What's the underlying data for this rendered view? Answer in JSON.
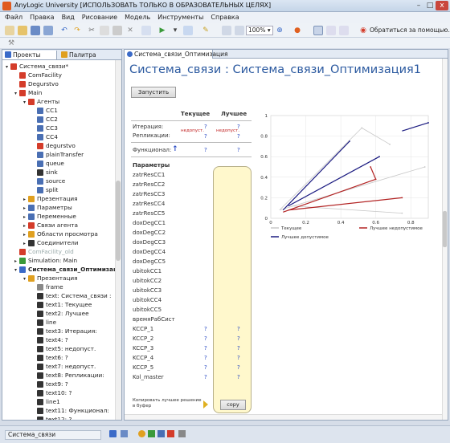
{
  "window": {
    "title": "AnyLogic University [ИСПОЛЬЗОВАТЬ ТОЛЬКО В ОБРАЗОВАТЕЛЬНЫХ ЦЕЛЯХ]",
    "minimize": "–",
    "maximize": "□",
    "close": "x"
  },
  "menu": [
    "Файл",
    "Правка",
    "Вид",
    "Рисование",
    "Модель",
    "Инструменты",
    "Справка"
  ],
  "toolbar": {
    "zoom": "100%",
    "support_label": "Обратиться за помощью..."
  },
  "left_panel": {
    "tabs": [
      "Проекты",
      "Палитра"
    ],
    "tree": [
      {
        "label": "Система_связи*",
        "indent": 0,
        "expander": "▾",
        "icon": "model-icon",
        "color": "#d43c2a"
      },
      {
        "label": "ComFacility",
        "indent": 1,
        "expander": "",
        "icon": "agent-icon",
        "color": "#d43c2a"
      },
      {
        "label": "Degurstvo",
        "indent": 1,
        "expander": "",
        "icon": "agent-icon",
        "color": "#d43c2a"
      },
      {
        "label": "Main",
        "indent": 1,
        "expander": "▾",
        "icon": "agent-icon",
        "color": "#d43c2a"
      },
      {
        "label": "Агенты",
        "indent": 2,
        "expander": "▾",
        "icon": "agents-icon",
        "color": "#d43c2a"
      },
      {
        "label": "CC1",
        "indent": 3,
        "expander": "",
        "icon": "service-icon",
        "color": "#4a6fb3"
      },
      {
        "label": "CC2",
        "indent": 3,
        "expander": "",
        "icon": "service-icon",
        "color": "#4a6fb3"
      },
      {
        "label": "CC3",
        "indent": 3,
        "expander": "",
        "icon": "service-icon",
        "color": "#4a6fb3"
      },
      {
        "label": "CC4",
        "indent": 3,
        "expander": "",
        "icon": "service-icon",
        "color": "#4a6fb3"
      },
      {
        "label": "degurstvo",
        "indent": 3,
        "expander": "",
        "icon": "agent-icon",
        "color": "#d43c2a"
      },
      {
        "label": "plainTransfer",
        "indent": 3,
        "expander": "",
        "icon": "block-icon",
        "color": "#4a6fb3"
      },
      {
        "label": "queue",
        "indent": 3,
        "expander": "",
        "icon": "queue-icon",
        "color": "#4a6fb3"
      },
      {
        "label": "sink",
        "indent": 3,
        "expander": "",
        "icon": "sink-icon",
        "color": "#333333"
      },
      {
        "label": "source",
        "indent": 3,
        "expander": "",
        "icon": "source-icon",
        "color": "#4a6fb3"
      },
      {
        "label": "split",
        "indent": 3,
        "expander": "",
        "icon": "split-icon",
        "color": "#4a6fb3"
      },
      {
        "label": "Презентация",
        "indent": 2,
        "expander": "▸",
        "icon": "presentation-icon",
        "color": "#e0a020"
      },
      {
        "label": "Параметры",
        "indent": 2,
        "expander": "▸",
        "icon": "parameters-icon",
        "color": "#4a6fb3"
      },
      {
        "label": "Переменные",
        "indent": 2,
        "expander": "▸",
        "icon": "variables-icon",
        "color": "#4a6fb3"
      },
      {
        "label": "Связи агента",
        "indent": 2,
        "expander": "▸",
        "icon": "links-icon",
        "color": "#d43c2a"
      },
      {
        "label": "Области просмотра",
        "indent": 2,
        "expander": "▸",
        "icon": "viewarea-icon",
        "color": "#e0a020"
      },
      {
        "label": "Соединители",
        "indent": 2,
        "expander": "▸",
        "icon": "connectors-icon",
        "color": "#333333"
      },
      {
        "label": "ComFacility_old",
        "indent": 1,
        "expander": "",
        "icon": "agent-icon",
        "color": "#d43c2a",
        "dim": true
      },
      {
        "label": "Simulation: Main",
        "indent": 1,
        "expander": "▸",
        "icon": "experiment-icon",
        "color": "#3a9a3a"
      },
      {
        "label": "Система_связи_Оптимизац",
        "indent": 1,
        "expander": "▾",
        "icon": "optimization-icon",
        "color": "#3a6ac8",
        "bold": true
      },
      {
        "label": "Презентация",
        "indent": 2,
        "expander": "▾",
        "icon": "presentation-icon",
        "color": "#e0a020"
      },
      {
        "label": "frame",
        "indent": 3,
        "expander": "",
        "icon": "frame-icon",
        "color": "#888888"
      },
      {
        "label": "text: Система_связи :",
        "indent": 3,
        "expander": "",
        "icon": "text-icon",
        "color": "#333333"
      },
      {
        "label": "text1: Текущее",
        "indent": 3,
        "expander": "",
        "icon": "text-icon",
        "color": "#333333"
      },
      {
        "label": "text2: Лучшее",
        "indent": 3,
        "expander": "",
        "icon": "text-icon",
        "color": "#333333"
      },
      {
        "label": "line",
        "indent": 3,
        "expander": "",
        "icon": "line-icon",
        "color": "#333333"
      },
      {
        "label": "text3: Итерация:",
        "indent": 3,
        "expander": "",
        "icon": "text-icon",
        "color": "#333333"
      },
      {
        "label": "text4: ?",
        "indent": 3,
        "expander": "",
        "icon": "text-icon",
        "color": "#333333"
      },
      {
        "label": "text5: недопуст.",
        "indent": 3,
        "expander": "",
        "icon": "text-icon",
        "color": "#333333"
      },
      {
        "label": "text6: ?",
        "indent": 3,
        "expander": "",
        "icon": "text-icon",
        "color": "#333333"
      },
      {
        "label": "text7: недопуст.",
        "indent": 3,
        "expander": "",
        "icon": "text-icon",
        "color": "#333333"
      },
      {
        "label": "text8: Репликации:",
        "indent": 3,
        "expander": "",
        "icon": "text-icon",
        "color": "#333333"
      },
      {
        "label": "text9: ?",
        "indent": 3,
        "expander": "",
        "icon": "text-icon",
        "color": "#333333"
      },
      {
        "label": "text10: ?",
        "indent": 3,
        "expander": "",
        "icon": "text-icon",
        "color": "#333333"
      },
      {
        "label": "line1",
        "indent": 3,
        "expander": "",
        "icon": "line-icon",
        "color": "#333333"
      },
      {
        "label": "text11: Функционал:",
        "indent": 3,
        "expander": "",
        "icon": "text-icon",
        "color": "#333333"
      },
      {
        "label": "text12: ?",
        "indent": 3,
        "expander": "",
        "icon": "text-icon",
        "color": "#333333"
      }
    ]
  },
  "editor": {
    "tab": "Система_связи_Оптимизация",
    "heading": "Система_связи : Система_связи_Оптимизация1",
    "run_button": "Запустить",
    "col_current": "Текущее",
    "col_best": "Лучшее",
    "rows": [
      {
        "label": "Итерация:",
        "current": "?",
        "best": "?"
      },
      {
        "label": "Репликации:",
        "current": "?",
        "best": "?"
      }
    ],
    "infeasible": "недопуст.",
    "functional_label": "Функционал:",
    "functional_arrow": "↑",
    "functional_current": "?",
    "functional_best": "?",
    "params_title": "Параметры",
    "params": [
      "zatrResCC1",
      "zatrResCC2",
      "zatrResCC3",
      "zatrResCC4",
      "zatrResCC5",
      "doxDegCC1",
      "doxDegCC2",
      "doxDegCC3",
      "doxDegCC4",
      "doxDegCC5",
      "ubitokCC1",
      "ubitokCC2",
      "ubitokCC3",
      "ubitokCC4",
      "ubitokCC5",
      "времяРабСист",
      "KCCP_1",
      "KCCP_2",
      "KCCP_3",
      "KCCP_4",
      "KCCP_5",
      "Kol_master"
    ],
    "param_values": {
      "KCCP_1": [
        "?",
        "?"
      ],
      "KCCP_2": [
        "?",
        "?"
      ],
      "KCCP_3": [
        "?",
        "?"
      ],
      "KCCP_4": [
        "?",
        "?"
      ],
      "KCCP_5": [
        "?",
        "?"
      ],
      "Kol_master": [
        "?",
        "?"
      ]
    },
    "copy_label": "Копировать лучшее решение в буфер",
    "copy_button": "copy"
  },
  "chart_data": {
    "type": "line",
    "x_ticks": [
      "0",
      "0.2",
      "0.4",
      "0.6",
      "0.8"
    ],
    "y_ticks": [
      "1",
      "0.8",
      "0.6",
      "0.4",
      "0.2",
      "0"
    ],
    "xlim": [
      0,
      0.9
    ],
    "ylim": [
      0,
      1
    ],
    "legend": [
      "Текущее",
      "Лучшее недопустимое",
      "Лучшее допустимое"
    ],
    "legend_placement": "bottom",
    "series": [
      {
        "name": "Текущее",
        "color": "#c8c8c8",
        "segments": [
          [
            [
              0.05,
              0.08
            ],
            [
              0.52,
              0.88
            ]
          ],
          [
            [
              0.52,
              0.88
            ],
            [
              0.68,
              0.72
            ]
          ],
          [
            [
              0.05,
              0.08
            ],
            [
              0.88,
              0.5
            ]
          ],
          [
            [
              0.12,
              0.12
            ],
            [
              0.75,
              0.05
            ]
          ]
        ]
      },
      {
        "name": "Лучшее недопустимое",
        "color": "#b22222",
        "segments": [
          [
            [
              0.07,
              0.06
            ],
            [
              0.6,
              0.38
            ]
          ],
          [
            [
              0.6,
              0.38
            ],
            [
              0.57,
              0.5
            ]
          ],
          [
            [
              0.1,
              0.08
            ],
            [
              0.75,
              0.2
            ]
          ]
        ]
      },
      {
        "name": "Лучшее допустимое",
        "color": "#1a1a80",
        "segments": [
          [
            [
              0.07,
              0.08
            ],
            [
              0.45,
              0.75
            ]
          ],
          [
            [
              0.1,
              0.12
            ],
            [
              0.62,
              0.6
            ]
          ],
          [
            [
              0.75,
              0.85
            ],
            [
              0.9,
              0.93
            ]
          ]
        ]
      }
    ]
  },
  "status": {
    "project": "Система_связи"
  }
}
